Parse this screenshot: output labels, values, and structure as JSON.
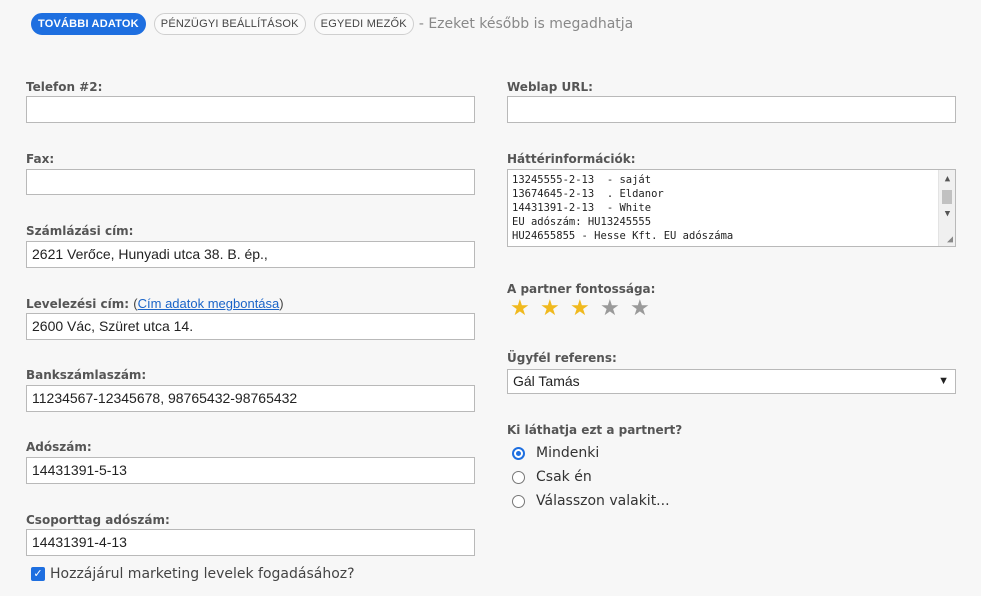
{
  "tabs": [
    {
      "label": "TOVÁBBI ADATOK",
      "active": true
    },
    {
      "label": "PÉNZÜGYI BEÁLLÍTÁSOK",
      "active": false
    },
    {
      "label": "EGYEDI MEZŐK",
      "active": false
    }
  ],
  "tabs_note": "- Ezeket később is megadhatja",
  "left": {
    "phone2": {
      "label": "Telefon #2:",
      "value": ""
    },
    "fax": {
      "label": "Fax:",
      "value": ""
    },
    "billing": {
      "label": "Számlázási cím:",
      "value": "2621 Verőce, Hunyadi utca 38. B. ép.,"
    },
    "postal": {
      "label": "Levelezési cím:",
      "link_open": "(",
      "link": "Cím adatok megbontása",
      "link_close": ")",
      "value": "2600 Vác, Szüret utca 14."
    },
    "bank": {
      "label": "Bankszámlaszám:",
      "value": "11234567-12345678, 98765432-98765432"
    },
    "tax": {
      "label": "Adószám:",
      "value": "14431391-5-13"
    },
    "group_tax": {
      "label": "Csoporttag adószám:",
      "value": "14431391-4-13"
    },
    "marketing": {
      "label": "Hozzájárul marketing levelek fogadásához?",
      "checked": true
    }
  },
  "right": {
    "website": {
      "label": "Weblap URL:",
      "value": ""
    },
    "background": {
      "label": "Háttérinformációk:",
      "text": "13245555-2-13  - saját\n13674645-2-13  . Eldanor\n14431391-2-13  - White\nEU adószám: HU13245555\nHU24655855 - Hesse Kft. EU adószáma"
    },
    "importance": {
      "label": "A partner fontossága:",
      "rating": 3,
      "max": 5
    },
    "referent": {
      "label": "Ügyfél referens:",
      "value": "Gál Tamás"
    },
    "visibility": {
      "label": "Ki láthatja ezt a partnert?",
      "options": [
        {
          "label": "Mindenki",
          "checked": true
        },
        {
          "label": "Csak én",
          "checked": false
        },
        {
          "label": "Válasszon valakit...",
          "checked": false
        }
      ]
    }
  }
}
